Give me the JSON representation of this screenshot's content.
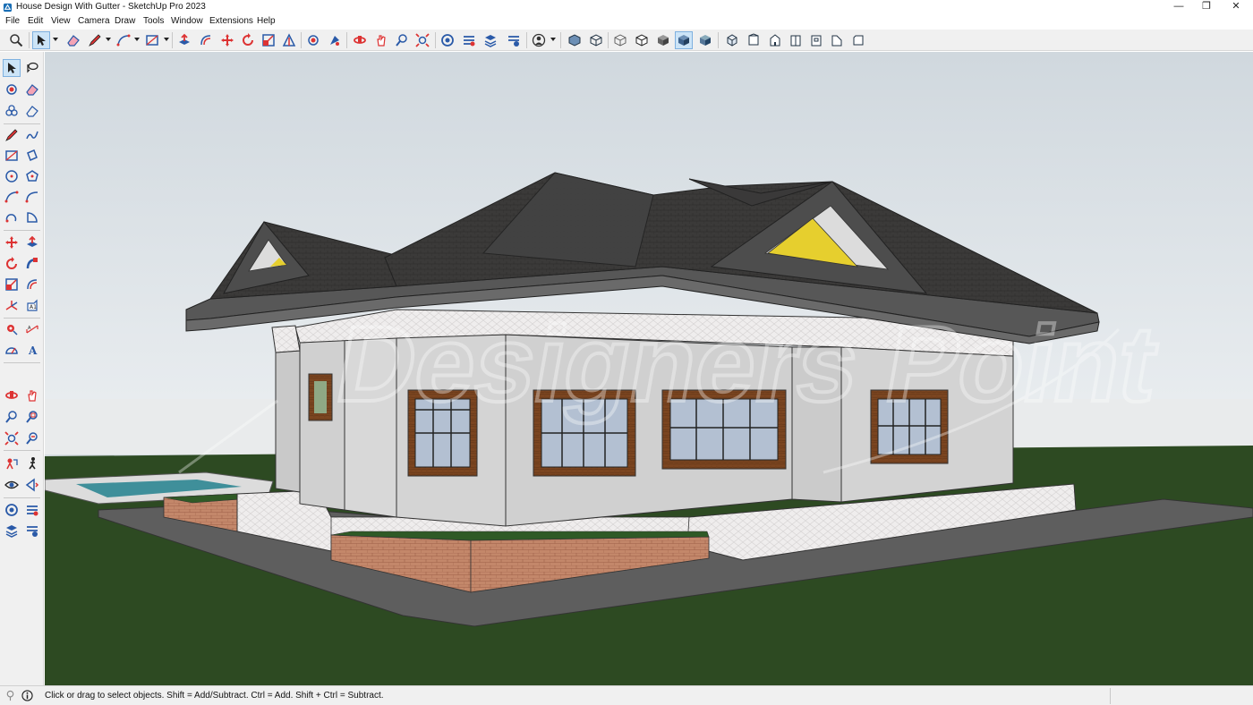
{
  "window": {
    "title": "House Design With Gutter - SketchUp Pro 2023",
    "controls": [
      "minimize",
      "restore",
      "close"
    ]
  },
  "menu": [
    "File",
    "Edit",
    "View",
    "Camera",
    "Draw",
    "Tools",
    "Window",
    "Extensions",
    "Help"
  ],
  "toolbar": {
    "groups": [
      [
        "search-icon"
      ],
      [
        "select-icon",
        "eraser-icon",
        "pencil-icon",
        "arc-icon",
        "rectangle-icon"
      ],
      [
        "push-pull-icon",
        "offset-icon",
        "move-icon",
        "rotate-icon",
        "scale-icon",
        "tape-measure-icon"
      ],
      [
        "paint-bucket-icon",
        "paint-sample-icon"
      ],
      [
        "orbit-icon",
        "pan-icon",
        "zoom-icon",
        "zoom-extents-icon"
      ],
      [
        "3d-warehouse-icon",
        "extension-warehouse-icon",
        "layout-icon",
        "extension-manager-icon"
      ],
      [
        "user-account-icon"
      ],
      [
        "xray-icon",
        "back-edges-icon",
        "wireframe-icon",
        "hidden-line-icon",
        "shaded-icon",
        "shaded-textures-icon",
        "monochrome-icon"
      ],
      [
        "iso-view-icon",
        "top-view-icon",
        "front-view-icon",
        "right-view-icon",
        "back-view-icon",
        "left-view-icon",
        "bottom-view-icon"
      ]
    ],
    "active_tool": "select-icon"
  },
  "left_toolbar": {
    "rows": [
      [
        "select-icon",
        "lasso-icon"
      ],
      [
        "paint-bucket-icon",
        "eraser-icon"
      ],
      [
        "make-component-icon",
        "tag-eraser-icon"
      ],
      [
        "line-icon",
        "freehand-icon"
      ],
      [
        "rectangle-icon",
        "rotated-rectangle-icon"
      ],
      [
        "circle-icon",
        "polygon-icon"
      ],
      [
        "arc-icon",
        "two-point-arc-icon"
      ],
      [
        "three-point-arc-icon",
        "pie-icon"
      ],
      [
        "move-icon",
        "push-pull-icon"
      ],
      [
        "rotate-icon",
        "follow-me-icon"
      ],
      [
        "scale-icon",
        "offset-icon"
      ],
      [
        "axes-icon",
        "text-icon"
      ],
      [
        "tape-measure-icon",
        "dimension-icon"
      ],
      [
        "protractor-icon",
        "label-icon"
      ],
      [
        "orbit-icon",
        "pan-icon"
      ],
      [
        "zoom-icon",
        "zoom-window-icon"
      ],
      [
        "zoom-extents-icon",
        "previous-view-icon"
      ],
      [
        "position-camera-icon",
        "walk-icon"
      ],
      [
        "look-around-icon",
        "section-plane-icon"
      ],
      [
        "3d-warehouse-icon",
        "extension-warehouse-icon"
      ],
      [
        "layout-icon",
        "extension-manager-icon"
      ]
    ],
    "active_tool": "select-icon"
  },
  "status": {
    "text": "Click or drag to select objects. Shift = Add/Subtract. Ctrl = Add. Shift + Ctrl = Subtract.",
    "icons": [
      "geo-location-icon",
      "info-icon"
    ],
    "measurements_value": ""
  },
  "scene": {
    "watermark": "Designers Point",
    "colors": {
      "sky": "#d6dde2",
      "ground": "#2d4a22",
      "roof": "#3a3938",
      "fascia": "#5a5a5a",
      "wall": "#d4d4d4",
      "trim": "#e9e6e6",
      "window_frame": "#7a4522",
      "glass": "#b3c0d2",
      "gable_glass": "#e6cf2e",
      "brick": "#b87a5a",
      "pool": "#3f8f9a",
      "paving": "#5e5e5e"
    }
  }
}
